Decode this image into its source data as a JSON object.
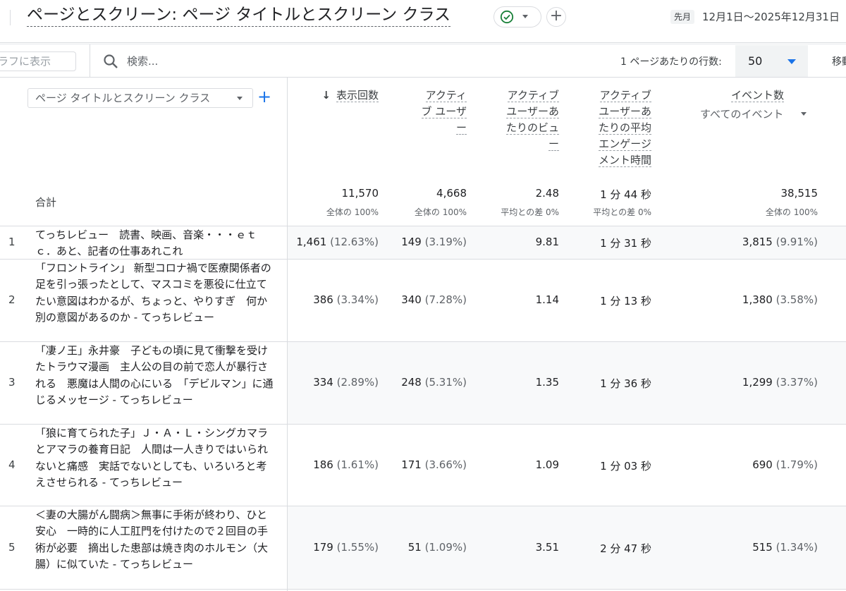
{
  "header": {
    "report_title": "ページとスクリーン: ページ タイトルとスクリーン クラス",
    "date_badge": "先月",
    "date_range": "12月1日〜2025年12月31日",
    "add_label": "+"
  },
  "toolbar": {
    "chart_toggle_label": "ラフに表示",
    "search_placeholder": "検索...",
    "rows_per_page_label": "1 ページあたりの行数:",
    "rows_per_page_value": "50",
    "move_label": "移動"
  },
  "table": {
    "dimension_select": "ページ タイトルとスクリーン クラス",
    "dimension_add": "+",
    "columns": [
      {
        "lines": [
          "表示回数"
        ],
        "sort_arrow": "↓"
      },
      {
        "lines": [
          "アクティ",
          "ブ ユーザ",
          "ー"
        ]
      },
      {
        "lines": [
          "アクティブ",
          "ユーザーあ",
          "たりのビュ",
          "ー"
        ]
      },
      {
        "lines": [
          "アクティブ",
          "ユーザーあ",
          "たりの平均",
          "エンゲージ",
          "メント時間"
        ]
      },
      {
        "lines": [
          "イベント数"
        ],
        "sub": "すべてのイベント"
      }
    ],
    "totals": {
      "label": "合計",
      "values": [
        "11,570",
        "4,668",
        "2.48",
        "1 分 44 秒",
        "38,515"
      ],
      "subs": [
        "全体の 100%",
        "全体の 100%",
        "平均との差 0%",
        "平均との差 0%",
        "全体の 100%"
      ]
    },
    "rows": [
      {
        "index": "1",
        "title": "てっちレビュー　読書、映画、音楽・・・ｅｔｃ．あと、記者の仕事あれこれ",
        "views": "1,461",
        "views_pct": "(12.63%)",
        "users": "149",
        "users_pct": "(3.19%)",
        "views_per_user": "9.81",
        "engagement": "1 分 31 秒",
        "events": "3,815",
        "events_pct": "(9.91%)"
      },
      {
        "index": "2",
        "title": "「フロントライン」 新型コロナ禍で医療関係者の足を引っ張ったとして、マスコミを悪役に仕立てたい意図はわかるが、ちょっと、やりすぎ　何か別の意図があるのか - てっちレビュー",
        "views": "386",
        "views_pct": "(3.34%)",
        "users": "340",
        "users_pct": "(7.28%)",
        "views_per_user": "1.14",
        "engagement": "1 分 13 秒",
        "events": "1,380",
        "events_pct": "(3.58%)"
      },
      {
        "index": "3",
        "title": "「凄ノ王」永井豪　子どもの頃に見て衝撃を受けたトラウマ漫画　主人公の目の前で恋人が暴行される　悪魔は人間の心にいる　「デビルマン」に通じるメッセージ - てっちレビュー",
        "views": "334",
        "views_pct": "(2.89%)",
        "users": "248",
        "users_pct": "(5.31%)",
        "views_per_user": "1.35",
        "engagement": "1 分 36 秒",
        "events": "1,299",
        "events_pct": "(3.37%)"
      },
      {
        "index": "4",
        "title": "「狼に育てられた子」Ｊ・Ａ・Ｌ・シングカマラとアマラの養育日記　人間は一人きりではいられないと痛感　実話でないとしても、いろいろと考えさせられる - てっちレビュー",
        "views": "186",
        "views_pct": "(1.61%)",
        "users": "171",
        "users_pct": "(3.66%)",
        "views_per_user": "1.09",
        "engagement": "1 分 03 秒",
        "events": "690",
        "events_pct": "(1.79%)"
      },
      {
        "index": "5",
        "title": "＜妻の大腸がん闘病＞無事に手術が終わり、ひと安心　一時的に人工肛門を付けたので２回目の手術が必要　摘出した患部は焼き肉のホルモン（大腸）に似ていた - てっちレビュー",
        "views": "179",
        "views_pct": "(1.55%)",
        "users": "51",
        "users_pct": "(1.09%)",
        "views_per_user": "3.51",
        "engagement": "2 分 47 秒",
        "events": "515",
        "events_pct": "(1.34%)"
      }
    ]
  },
  "icons": {
    "status": "check-circle-icon",
    "search": "search-icon",
    "sort": "arrow-down-icon",
    "dropdown": "caret-down-icon",
    "add": "plus-icon"
  },
  "colors": {
    "accent": "#1a73e8",
    "status_ok": "#188038",
    "row_highlight": "#f8f9fa"
  }
}
